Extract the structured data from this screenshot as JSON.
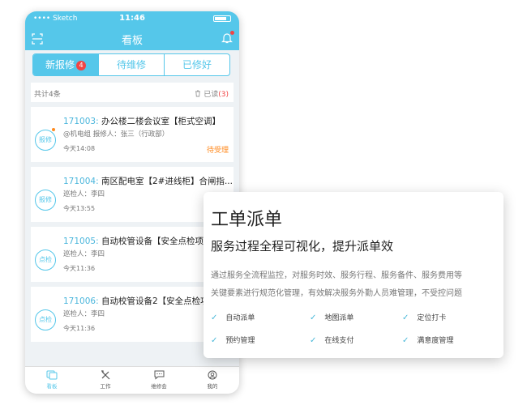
{
  "status_bar": {
    "carrier": "•••• Sketch",
    "time": "11:46"
  },
  "nav": {
    "title": "看板",
    "scan_icon": "scan-icon",
    "bell_icon": "bell-icon"
  },
  "tabs": [
    {
      "label": "新报修",
      "badge": "4",
      "active": true
    },
    {
      "label": "待维修",
      "active": false
    },
    {
      "label": "已修好",
      "active": false
    }
  ],
  "summary": {
    "count": "共计4条",
    "read_label": "已读",
    "read_count": "(3)"
  },
  "cards": [
    {
      "kind": "报修",
      "no": "171003:",
      "title": "办公楼二楼会议室【柜式空调】",
      "meta": "@机电组  报修人：张三（行政部）",
      "time": "今天14:08",
      "state": "待受理",
      "dot": true
    },
    {
      "kind": "报修",
      "no": "171004:",
      "title": "南区配电室【2#进线柜】合闸指...",
      "meta": "巡检人：李四",
      "time": "今天13:55"
    },
    {
      "kind": "点检",
      "no": "171005:",
      "title": "自动校管设备【安全点检项目",
      "meta": "巡检人：李四",
      "time": "今天11:36"
    },
    {
      "kind": "点检",
      "no": "171006:",
      "title": "自动校管设备2【安全点检项",
      "meta": "巡检人：李四",
      "time": "今天11:36"
    }
  ],
  "bottom_nav": [
    {
      "label": "看板",
      "icon": "board-icon",
      "active": true
    },
    {
      "label": "工作",
      "icon": "tools-icon"
    },
    {
      "label": "维修会",
      "icon": "chat-icon"
    },
    {
      "label": "我的",
      "icon": "user-icon"
    }
  ],
  "feature": {
    "title": "工单派单",
    "subtitle": "服务过程全程可视化，提升派单效",
    "desc1": "通过服务全流程监控，对服务时效、服务行程、服务备件、服务费用等",
    "desc2": "关键要素进行规范化管理，有效解决服务外勤人员难管理，不受控问题",
    "items": [
      "自动派单",
      "地图派单",
      "定位打卡",
      "预约管理",
      "在线支付",
      "满意度管理"
    ]
  }
}
